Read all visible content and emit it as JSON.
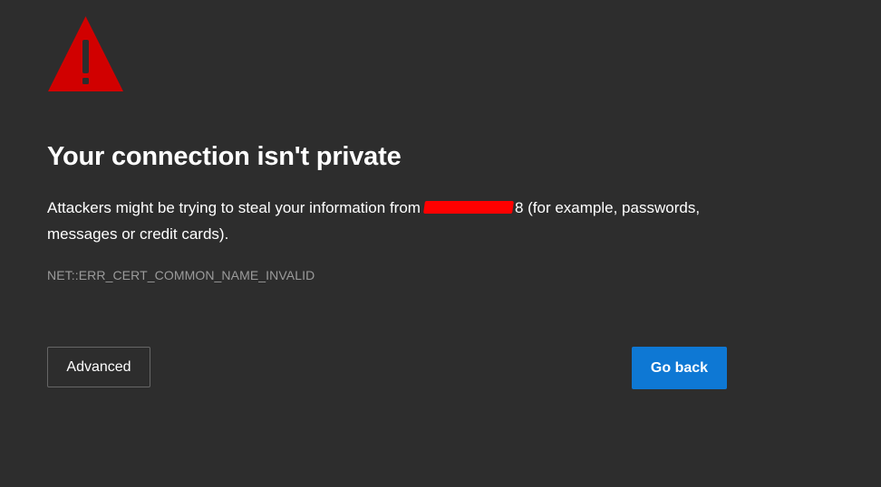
{
  "page": {
    "title": "Your connection isn't private",
    "description_before": "Attackers might be trying to steal your information from",
    "description_after": "8 (for example, passwords, messages or credit cards).",
    "error_code": "NET::ERR_CERT_COMMON_NAME_INVALID"
  },
  "icons": {
    "warning": "warning-triangle-icon"
  },
  "buttons": {
    "advanced_label": "Advanced",
    "back_label": "Go back"
  },
  "colors": {
    "background": "#2d2d2d",
    "warning": "#d10000",
    "primary_button": "#0e78d4",
    "error_code_text": "#9b9b9b"
  }
}
